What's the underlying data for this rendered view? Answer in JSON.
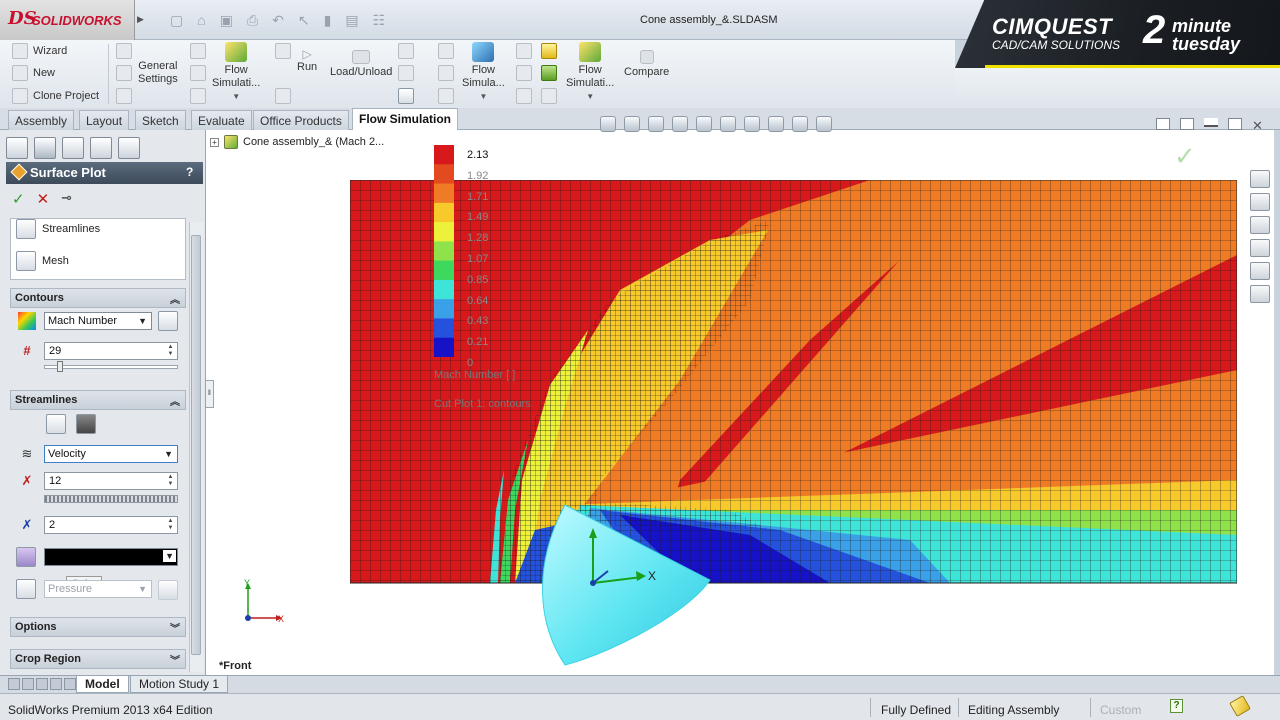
{
  "titlebar": {
    "app_logo_ds": "DS",
    "app_logo_name": "SOLIDWORKS",
    "document_title": "Cone assembly_&.SLDASM"
  },
  "banner": {
    "company": "CIMQUEST",
    "tagline": "CAD/CAM SOLUTIONS",
    "series_number": "2",
    "series_word1": "minute",
    "series_word2": "tuesday"
  },
  "ribbon": {
    "wizard": "Wizard",
    "new": "New",
    "clone_project": "Clone Project",
    "general_settings_l1": "General",
    "general_settings_l2": "Settings",
    "flow_sim1_l1": "Flow",
    "flow_sim1_l2": "Simulati...",
    "run": "Run",
    "load_unload": "Load/Unload",
    "flow_sim2_l1": "Flow",
    "flow_sim2_l2": "Simula...",
    "flow_sim3_l1": "Flow",
    "flow_sim3_l2": "Simulati...",
    "compare": "Compare"
  },
  "tabs": [
    "Assembly",
    "Layout",
    "Sketch",
    "Evaluate",
    "Office Products",
    "Flow Simulation"
  ],
  "tree": {
    "root": "Cone assembly_&  (Mach 2..."
  },
  "property_manager": {
    "title": "Surface Plot",
    "help": "?",
    "options_list": [
      "Streamlines",
      "Mesh"
    ],
    "contours": {
      "header": "Contours",
      "parameter": "Mach Number",
      "levels": "29"
    },
    "streamlines": {
      "header": "Streamlines",
      "parameter": "Velocity",
      "count": "12",
      "width": "2",
      "color_tooltip": "Color",
      "color_by": "Pressure"
    },
    "options_header": "Options",
    "crop_header": "Crop Region"
  },
  "legend": {
    "values": [
      "2.13",
      "1.92",
      "1.71",
      "1.49",
      "1.28",
      "1.07",
      "0.85",
      "0.64",
      "0.43",
      "0.21",
      "0"
    ],
    "title": "Mach Number [ ]",
    "subtitle": "Cut Plot 1: contours",
    "colors": [
      "#d7191c",
      "#e34a1f",
      "#f07b25",
      "#f8c92b",
      "#eef13a",
      "#8fe24a",
      "#3fd85e",
      "#3fe4d8",
      "#3aa0e8",
      "#2552dc",
      "#1612c8"
    ]
  },
  "graphics": {
    "view_name": "*Front",
    "triad_y": "Y",
    "triad_x": "X",
    "model_x": "X"
  },
  "bottom_tabs": [
    "Model",
    "Motion Study 1"
  ],
  "statusbar": {
    "edition": "SolidWorks Premium 2013 x64 Edition",
    "defined": "Fully Defined",
    "mode": "Editing Assembly",
    "units": "Custom"
  }
}
